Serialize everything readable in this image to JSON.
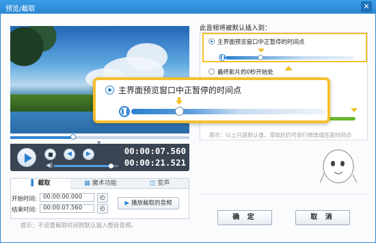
{
  "window": {
    "title": "预览/截取",
    "close_glyph": "✕"
  },
  "player": {
    "position_fraction": 0.35,
    "volume_fraction": 0.88,
    "current_time": "00:00:07.560",
    "total_time": "00:00:21.521"
  },
  "tabs": [
    {
      "label": "截取",
      "icon": "scissors-icon",
      "active": true
    },
    {
      "label": "魔术功能",
      "icon": "magic-icon",
      "active": false
    },
    {
      "label": "变声",
      "icon": "voice-icon",
      "active": false
    }
  ],
  "clip": {
    "start_label": "开始时间:",
    "start_value": "00:00:00.000",
    "end_label": "结束时间:",
    "end_value": "00:00:07.560",
    "play_clip_label": "播放截取的音频"
  },
  "left_hint": "提示：不设置截取时间则默认插入整段音频。",
  "insert": {
    "title": "此音频将被默认插入到：",
    "option1_label": "主界面预览窗口中正暂停的时间点",
    "option2_label": "最终影片的0秒开始处",
    "hint": "提示：以上只是默认值，添加后仍可自行修改成任意时间点"
  },
  "callout": {
    "label": "主界面预览窗口中正暂停的时间点",
    "position_fraction": 0.26
  },
  "buttons": {
    "ok": "确 定",
    "cancel": "取 消"
  },
  "colors": {
    "accent": "#2b80cf",
    "highlight": "#f5bf2d",
    "titlebar": "#2b86d4"
  }
}
